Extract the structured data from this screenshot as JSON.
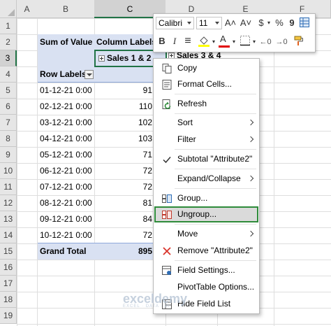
{
  "columns": [
    "A",
    "B",
    "C",
    "D",
    "E",
    "F"
  ],
  "rows": [
    "1",
    "2",
    "3",
    "4",
    "5",
    "6",
    "7",
    "8",
    "9",
    "10",
    "11",
    "12",
    "13",
    "14",
    "15",
    "16",
    "17",
    "18",
    "19"
  ],
  "pivot": {
    "sum_of_value": "Sum of Value",
    "column_labels": "Column Labels",
    "group1": "Sales 1 & 2",
    "group2": "Sales 3 & 4",
    "row_labels": "Row Labels",
    "dates": [
      "01-12-21 0:00",
      "02-12-21 0:00",
      "03-12-21 0:00",
      "04-12-21 0:00",
      "05-12-21 0:00",
      "06-12-21 0:00",
      "07-12-21 0:00",
      "08-12-21 0:00",
      "09-12-21 0:00",
      "10-12-21 0:00"
    ],
    "values_visible": [
      "91",
      "110",
      "102",
      "103",
      "71",
      "72",
      "72",
      "81",
      "84",
      "72"
    ],
    "grand_total_label": "Grand Total",
    "grand_total_visible": "895"
  },
  "mini_toolbar": {
    "font": "Calibri",
    "size": "11",
    "grow": "A˄",
    "shrink": "A˅",
    "currency": "$",
    "percent": "%",
    "comma": "9",
    "bold": "B",
    "italic": "I",
    "align": "≡",
    "font_color_letter": "A"
  },
  "menu": {
    "copy": "Copy",
    "format_cells": "Format Cells...",
    "refresh": "Refresh",
    "sort": "Sort",
    "filter": "Filter",
    "subtotal": "Subtotal \"Attribute2\"",
    "expand_collapse": "Expand/Collapse",
    "group": "Group...",
    "ungroup": "Ungroup...",
    "move": "Move",
    "remove": "Remove \"Attribute2\"",
    "field_settings": "Field Settings...",
    "pivot_options": "PivotTable Options...",
    "hide_field_list": "Hide Field List"
  },
  "watermark": {
    "name": "exceldemy",
    "tag": "EXCEL · DATA · BI"
  },
  "colors": {
    "accent": "#217346",
    "pivot_header": "#d9e1f2",
    "highlight_box": "#2e8b3a",
    "remove_x": "#d9342b"
  }
}
